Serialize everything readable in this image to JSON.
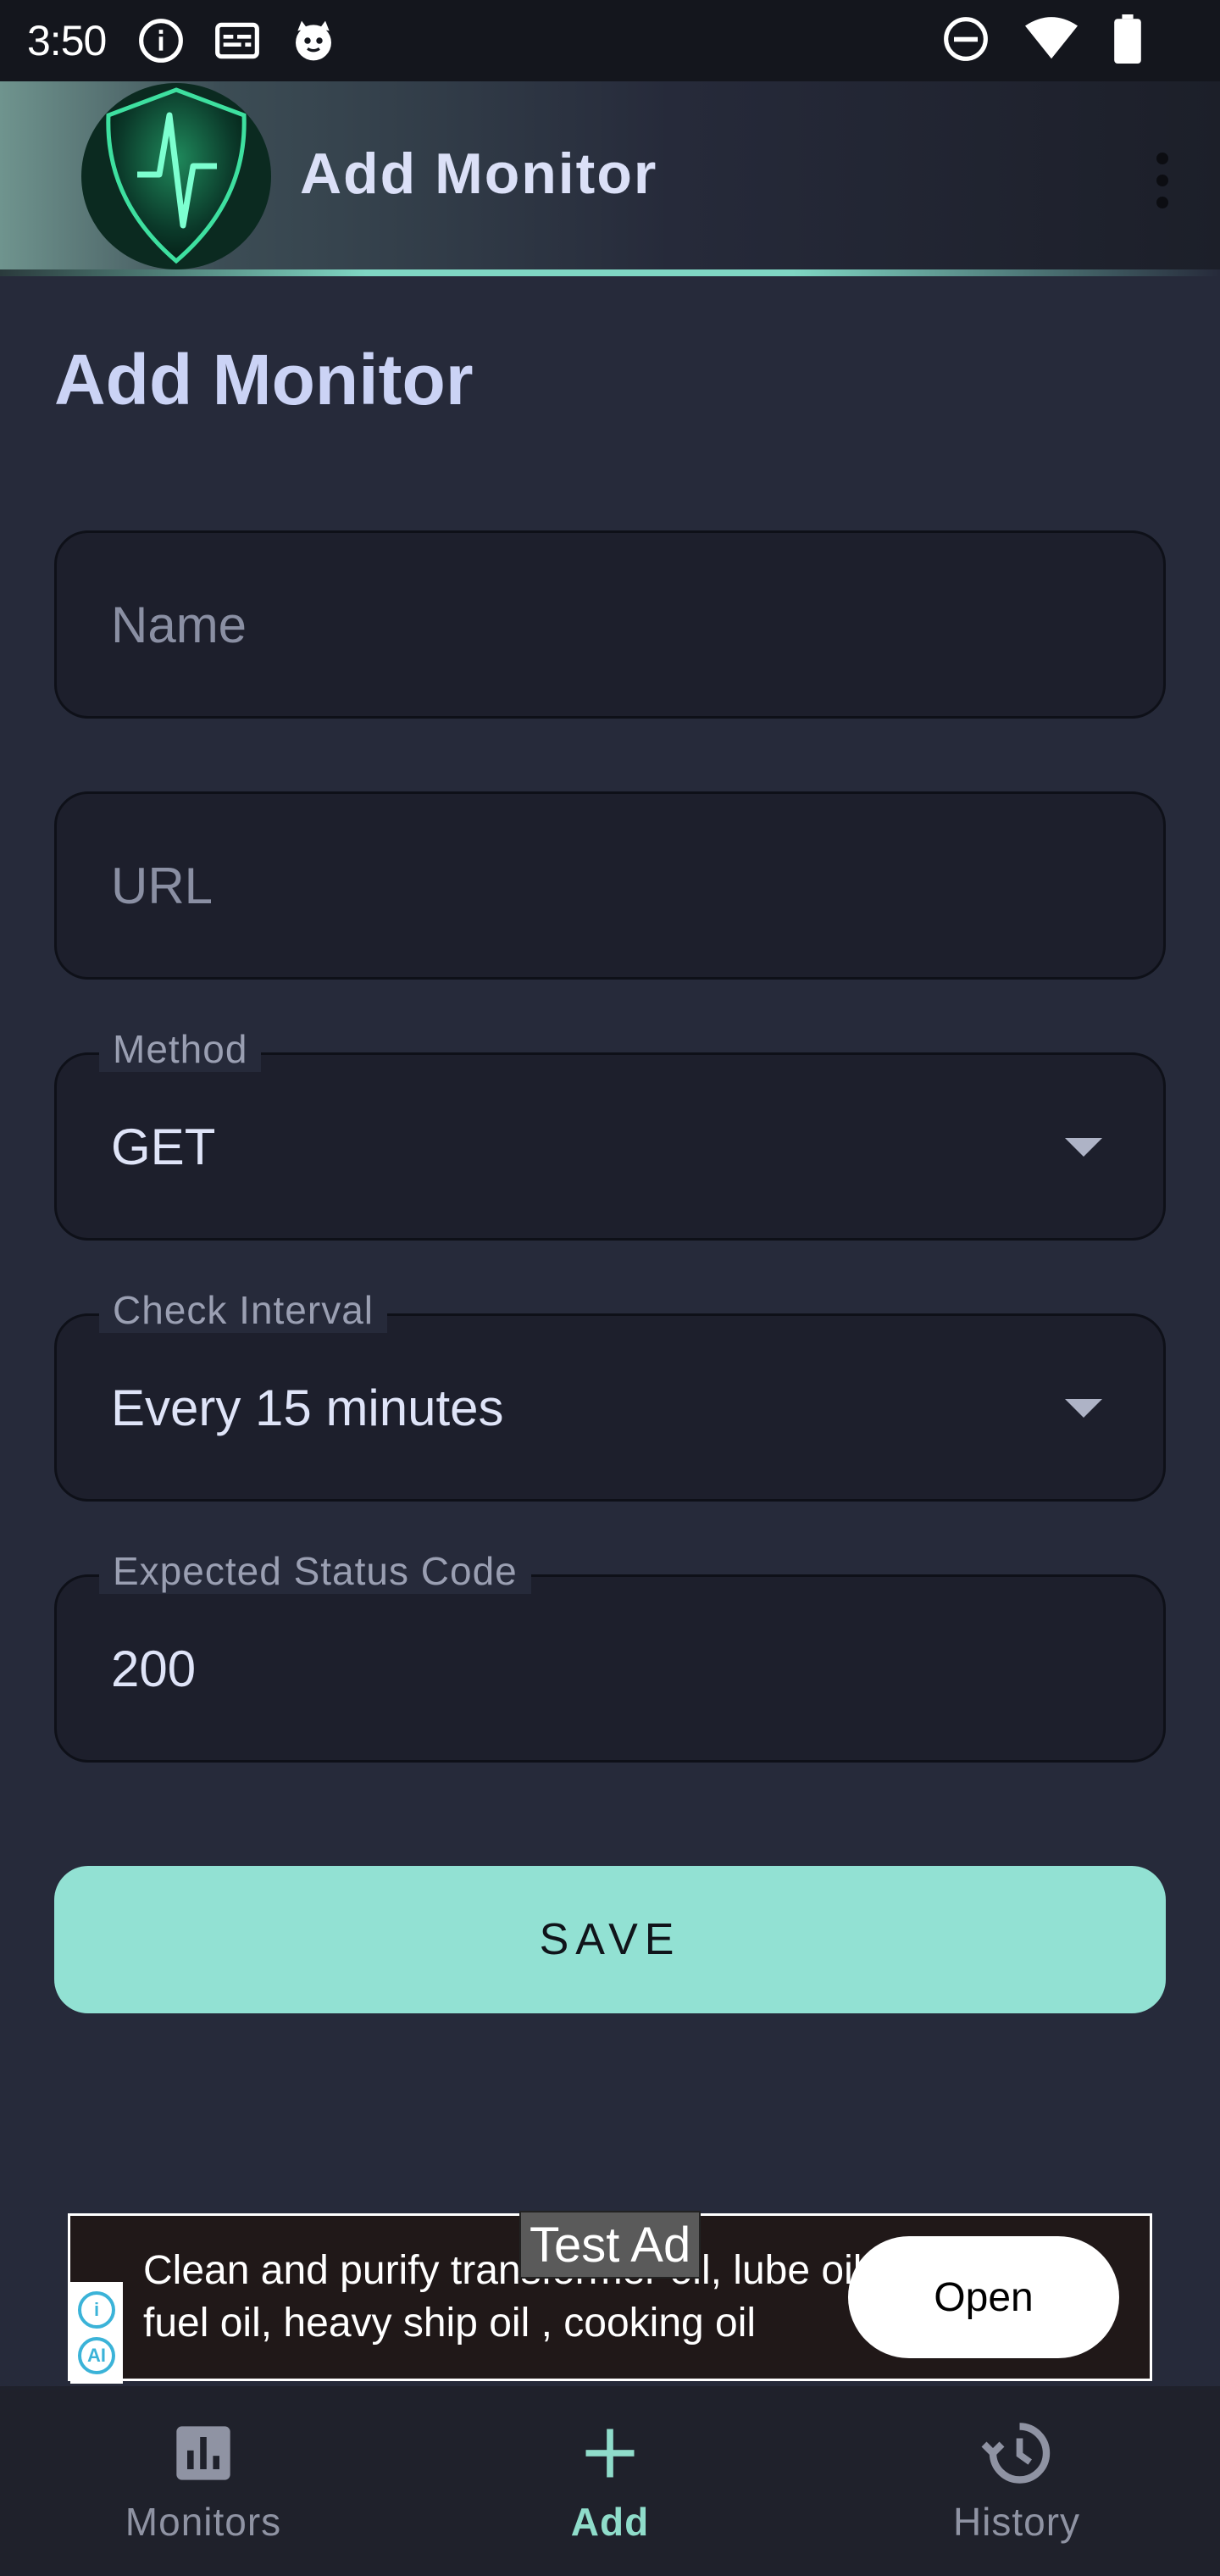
{
  "status_bar": {
    "time": "3:50"
  },
  "app_bar": {
    "title": "Add Monitor"
  },
  "page": {
    "title": "Add Monitor"
  },
  "form": {
    "name": {
      "value": "",
      "placeholder": "Name"
    },
    "url": {
      "value": "",
      "placeholder": "URL"
    },
    "method": {
      "label": "Method",
      "value": "GET"
    },
    "check_interval": {
      "label": "Check Interval",
      "value": "Every 15 minutes"
    },
    "expected_status_code": {
      "label": "Expected Status Code",
      "value": "200"
    },
    "save_label": "SAVE"
  },
  "ad": {
    "badge": "Test Ad",
    "text": "Clean and purify transformer oil, lube oil, fuel oil, heavy ship oil , cooking oil",
    "cta": "Open"
  },
  "bottom_nav": {
    "items": [
      {
        "label": "Monitors",
        "icon": "bar-chart-icon",
        "active": false
      },
      {
        "label": "Add",
        "icon": "plus-icon",
        "active": true
      },
      {
        "label": "History",
        "icon": "history-icon",
        "active": false
      }
    ]
  },
  "colors": {
    "background": "#262a3a",
    "accent": "#92e1d3",
    "field_bg": "#1d1f2c",
    "nav_active": "#8fdcca"
  }
}
